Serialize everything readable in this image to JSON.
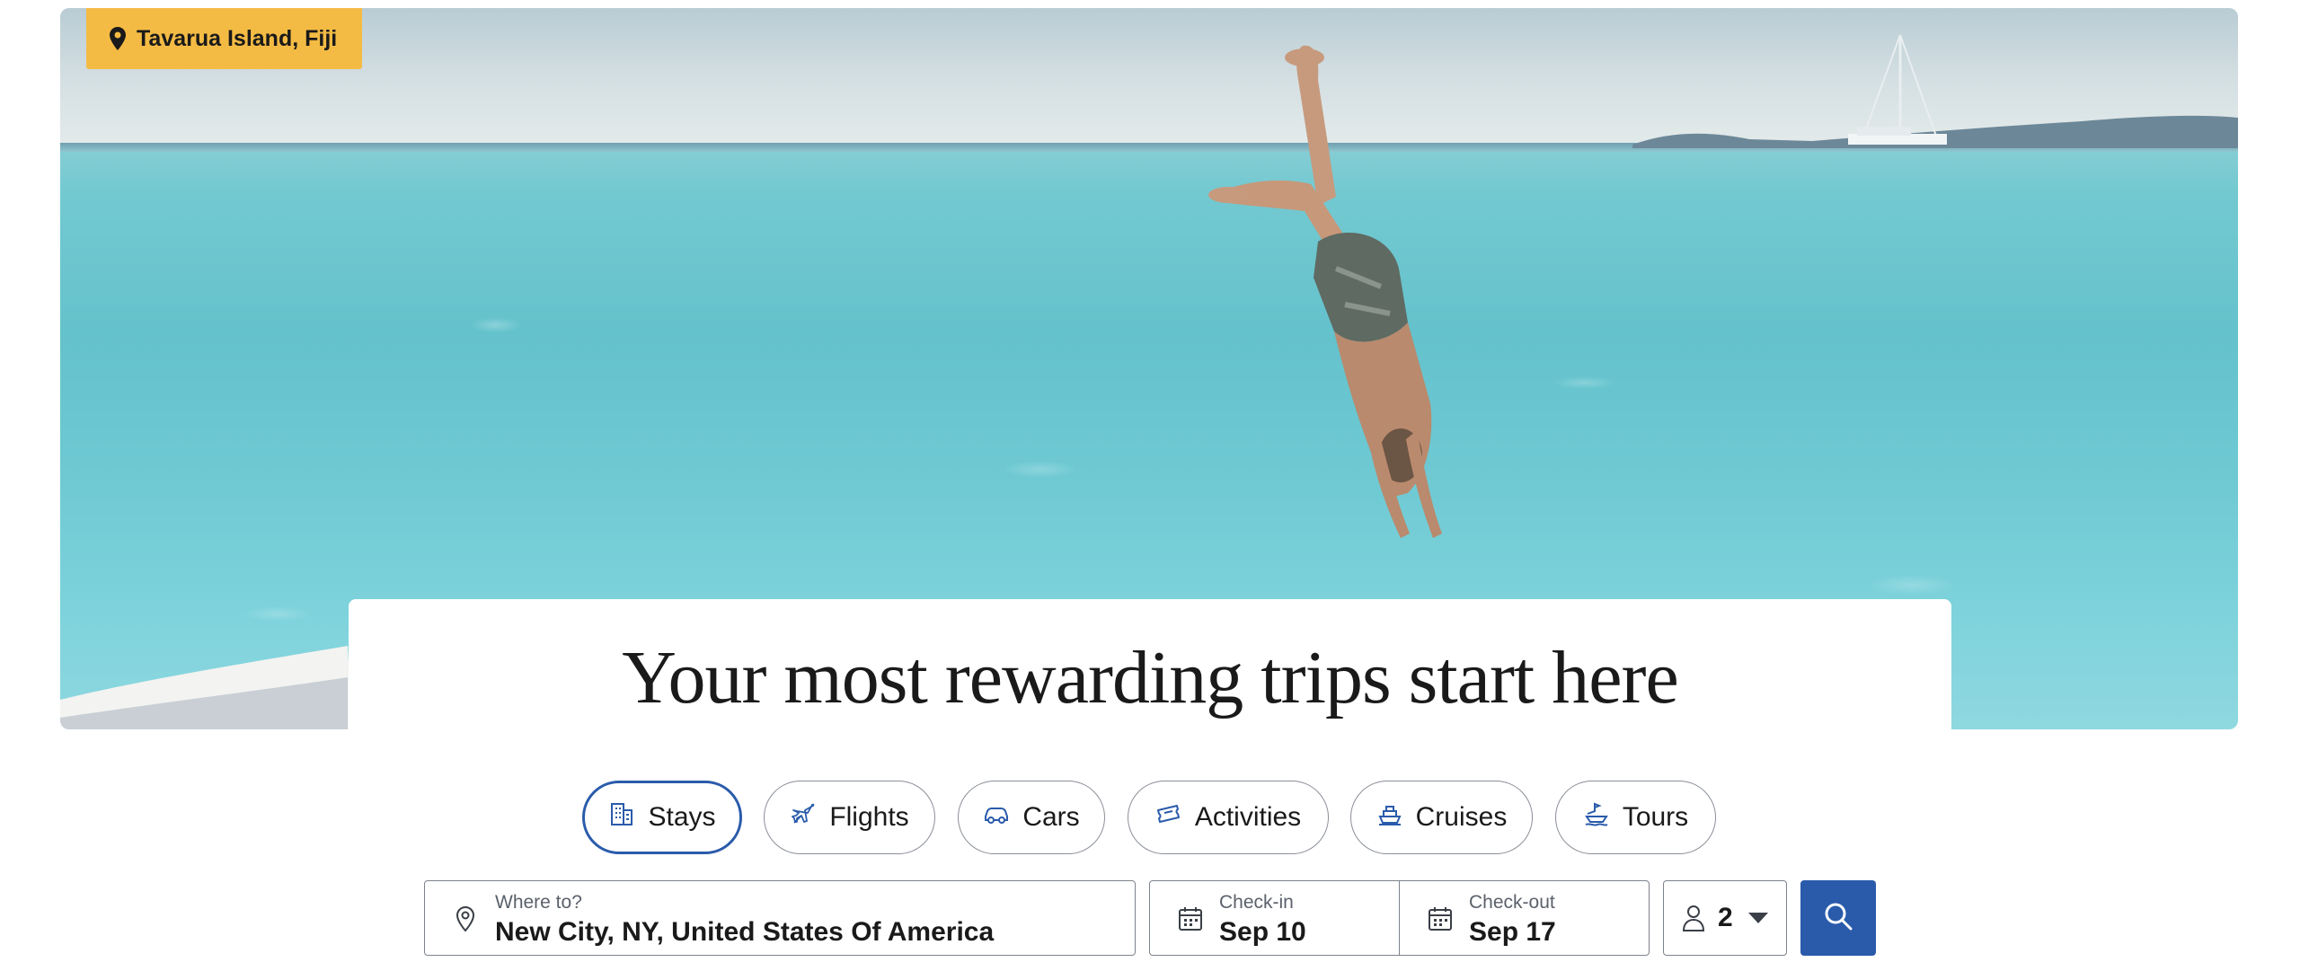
{
  "hero": {
    "location": "Tavarua Island, Fiji",
    "headline": "Your most rewarding trips start here"
  },
  "tabs": [
    {
      "label": "Stays",
      "icon": "building-icon",
      "active": true
    },
    {
      "label": "Flights",
      "icon": "plane-icon",
      "active": false
    },
    {
      "label": "Cars",
      "icon": "car-icon",
      "active": false
    },
    {
      "label": "Activities",
      "icon": "ticket-icon",
      "active": false
    },
    {
      "label": "Cruises",
      "icon": "ship-icon",
      "active": false
    },
    {
      "label": "Tours",
      "icon": "tour-icon",
      "active": false
    }
  ],
  "search": {
    "where_label": "Where to?",
    "where_value": "New City, NY, United States Of America",
    "checkin_label": "Check-in",
    "checkin_value": "Sep 10",
    "checkout_label": "Check-out",
    "checkout_value": "Sep 17",
    "travelers": "2"
  },
  "colors": {
    "accent": "#2a5bab",
    "badge": "#f4bb44"
  }
}
